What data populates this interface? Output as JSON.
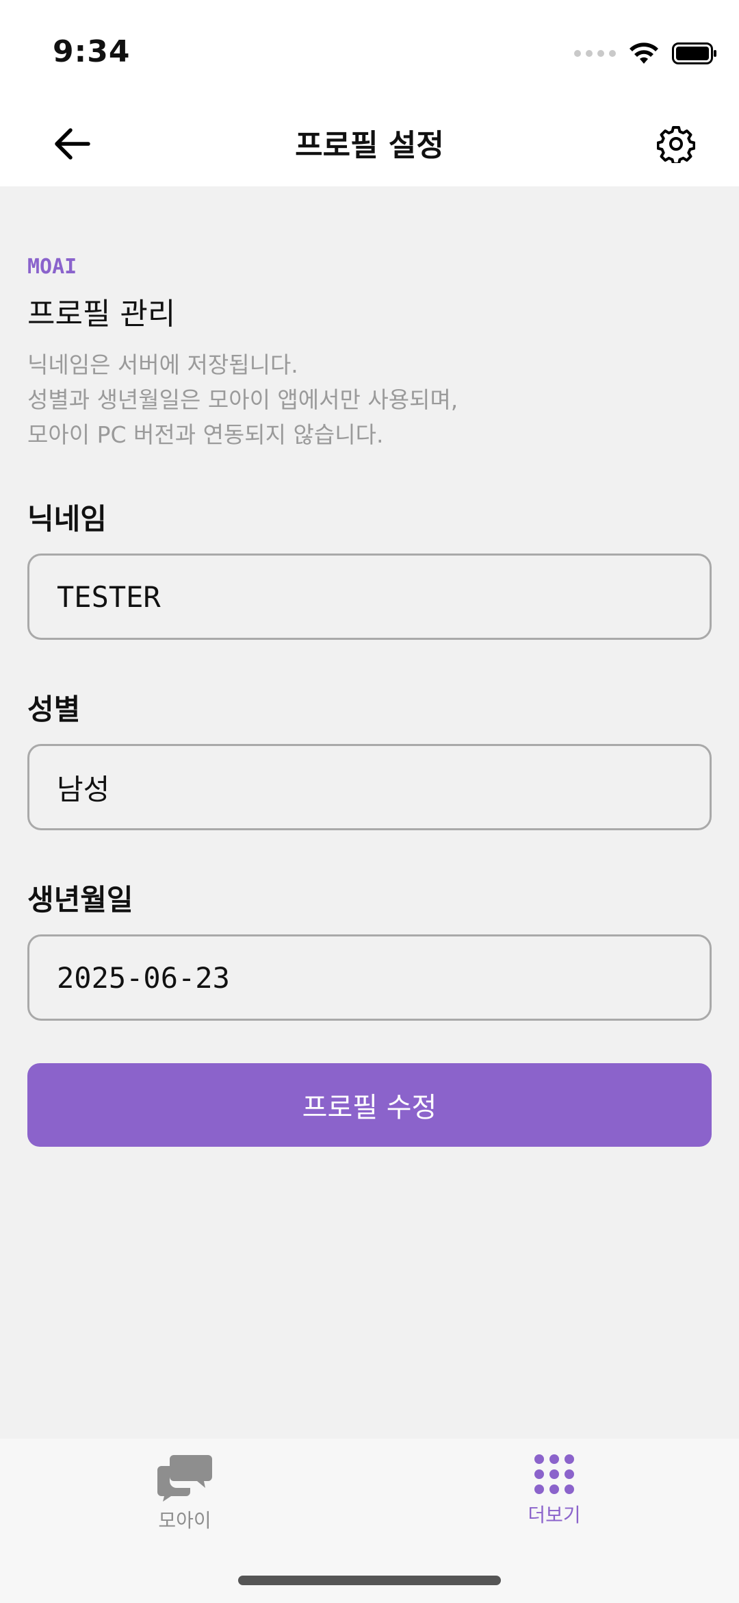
{
  "status": {
    "time": "9:34"
  },
  "header": {
    "title": "프로필 설정",
    "back_icon": "arrow-left-icon",
    "settings_icon": "gear-icon"
  },
  "profile": {
    "brand": "MOAI",
    "section_title": "프로필 관리",
    "description": [
      "닉네임은 서버에 저장됩니다.",
      "성별과 생년월일은 모아이 앱에서만 사용되며,",
      "모아이 PC 버전과 연동되지 않습니다."
    ],
    "nickname": {
      "label": "닉네임",
      "value": "TESTER"
    },
    "gender": {
      "label": "성별",
      "value": "남성"
    },
    "birthdate": {
      "label": "생년월일",
      "value": "2025-06-23"
    },
    "submit_label": "프로필 수정"
  },
  "colors": {
    "accent": "#8b63cb",
    "background": "#f1f1f1"
  },
  "tabs": [
    {
      "label": "모아이",
      "icon": "chat-bubbles-icon",
      "active": false
    },
    {
      "label": "더보기",
      "icon": "grid-dots-icon",
      "active": true
    }
  ]
}
